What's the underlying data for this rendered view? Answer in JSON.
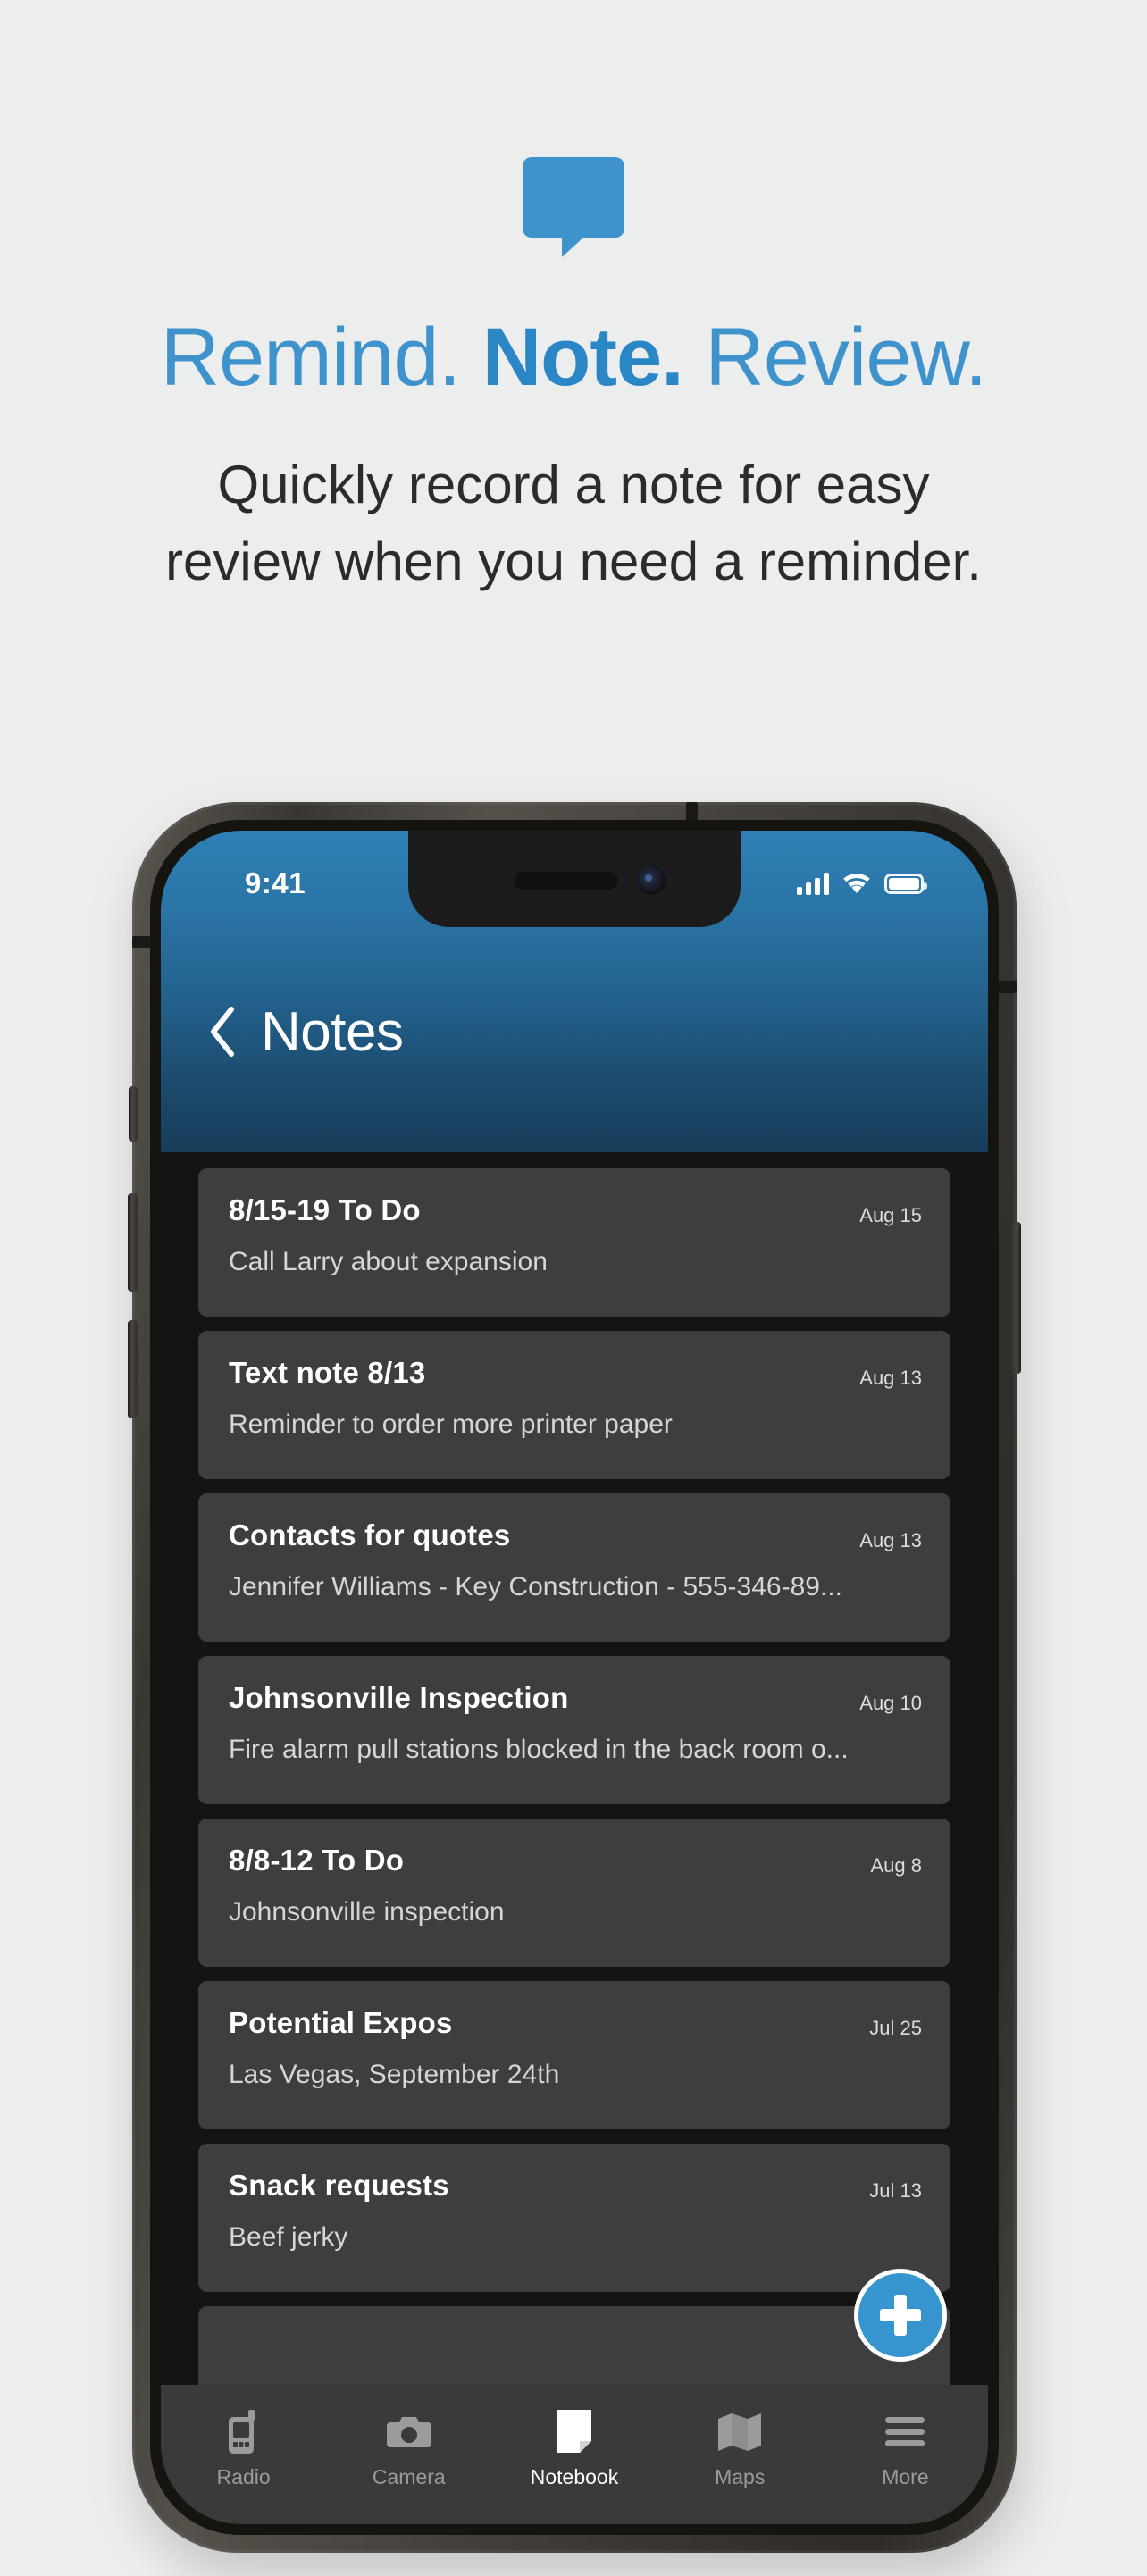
{
  "promo": {
    "logo_icon": "speech-bubble-icon",
    "accent_color": "#3f93cd",
    "headline_part1": "Remind.",
    "headline_part2": "Note.",
    "headline_part3": "Review.",
    "subhead_line1": "Quickly record a note for easy",
    "subhead_line2": "review when you need a reminder."
  },
  "phone": {
    "status": {
      "time": "9:41",
      "signal_icon": "cellular-signal-icon",
      "wifi_icon": "wifi-icon",
      "battery_icon": "battery-full-icon"
    },
    "nav": {
      "back_icon": "chevron-left-icon",
      "title": "Notes"
    },
    "fab": {
      "icon": "plus-icon",
      "color": "#3694cf"
    },
    "notes": [
      {
        "title": "8/15-19 To Do",
        "body": "Call Larry about expansion",
        "date": "Aug 15"
      },
      {
        "title": "Text note 8/13",
        "body": "Reminder to order more printer paper",
        "date": "Aug 13"
      },
      {
        "title": "Contacts for quotes",
        "body": "Jennifer Williams - Key Construction - 555-346-89...",
        "date": "Aug 13"
      },
      {
        "title": "Johnsonville Inspection",
        "body": "Fire alarm pull stations blocked in the back room o...",
        "date": "Aug 10"
      },
      {
        "title": "8/8-12 To Do",
        "body": "Johnsonville inspection",
        "date": "Aug 8"
      },
      {
        "title": "Potential Expos",
        "body": "Las Vegas, September 24th",
        "date": "Jul 25"
      },
      {
        "title": "Snack requests",
        "body": "Beef jerky",
        "date": "Jul 13"
      },
      {
        "title": "",
        "body": "",
        "date": ""
      }
    ],
    "tabs": [
      {
        "label": "Radio",
        "icon": "radio-icon",
        "active": false
      },
      {
        "label": "Camera",
        "icon": "camera-icon",
        "active": false
      },
      {
        "label": "Notebook",
        "icon": "notebook-icon",
        "active": true
      },
      {
        "label": "Maps",
        "icon": "map-icon",
        "active": false
      },
      {
        "label": "More",
        "icon": "menu-icon",
        "active": false
      }
    ]
  }
}
